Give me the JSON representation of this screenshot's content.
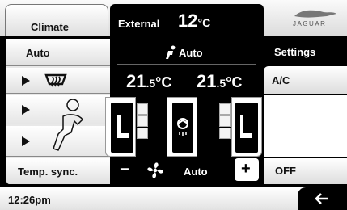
{
  "header": {
    "title": "Climate",
    "external_label": "External",
    "external_temp": "12",
    "external_unit": "°C",
    "brand": "JAGUAR"
  },
  "left_menu": {
    "auto": "Auto",
    "temp_sync": "Temp. sync."
  },
  "center": {
    "mode_label": "Auto",
    "left_temp_main": "21",
    "left_temp_dec": ".5",
    "left_temp_unit": "°C",
    "right_temp_main": "21",
    "right_temp_dec": ".5",
    "right_temp_unit": "°C",
    "fan_minus": "−",
    "fan_plus": "+",
    "fan_label": "Auto"
  },
  "right_menu": {
    "settings": "Settings",
    "ac": "A/C",
    "off": "OFF"
  },
  "footer": {
    "time": "12:26pm"
  },
  "icons": {
    "rear_defrost": "rear-window-defrost-icon",
    "airflow": "airflow-person-icon",
    "fan": "fan-icon",
    "back": "back-arrow-icon",
    "recirc": "recirculation-icon",
    "seat": "seat-icon"
  }
}
